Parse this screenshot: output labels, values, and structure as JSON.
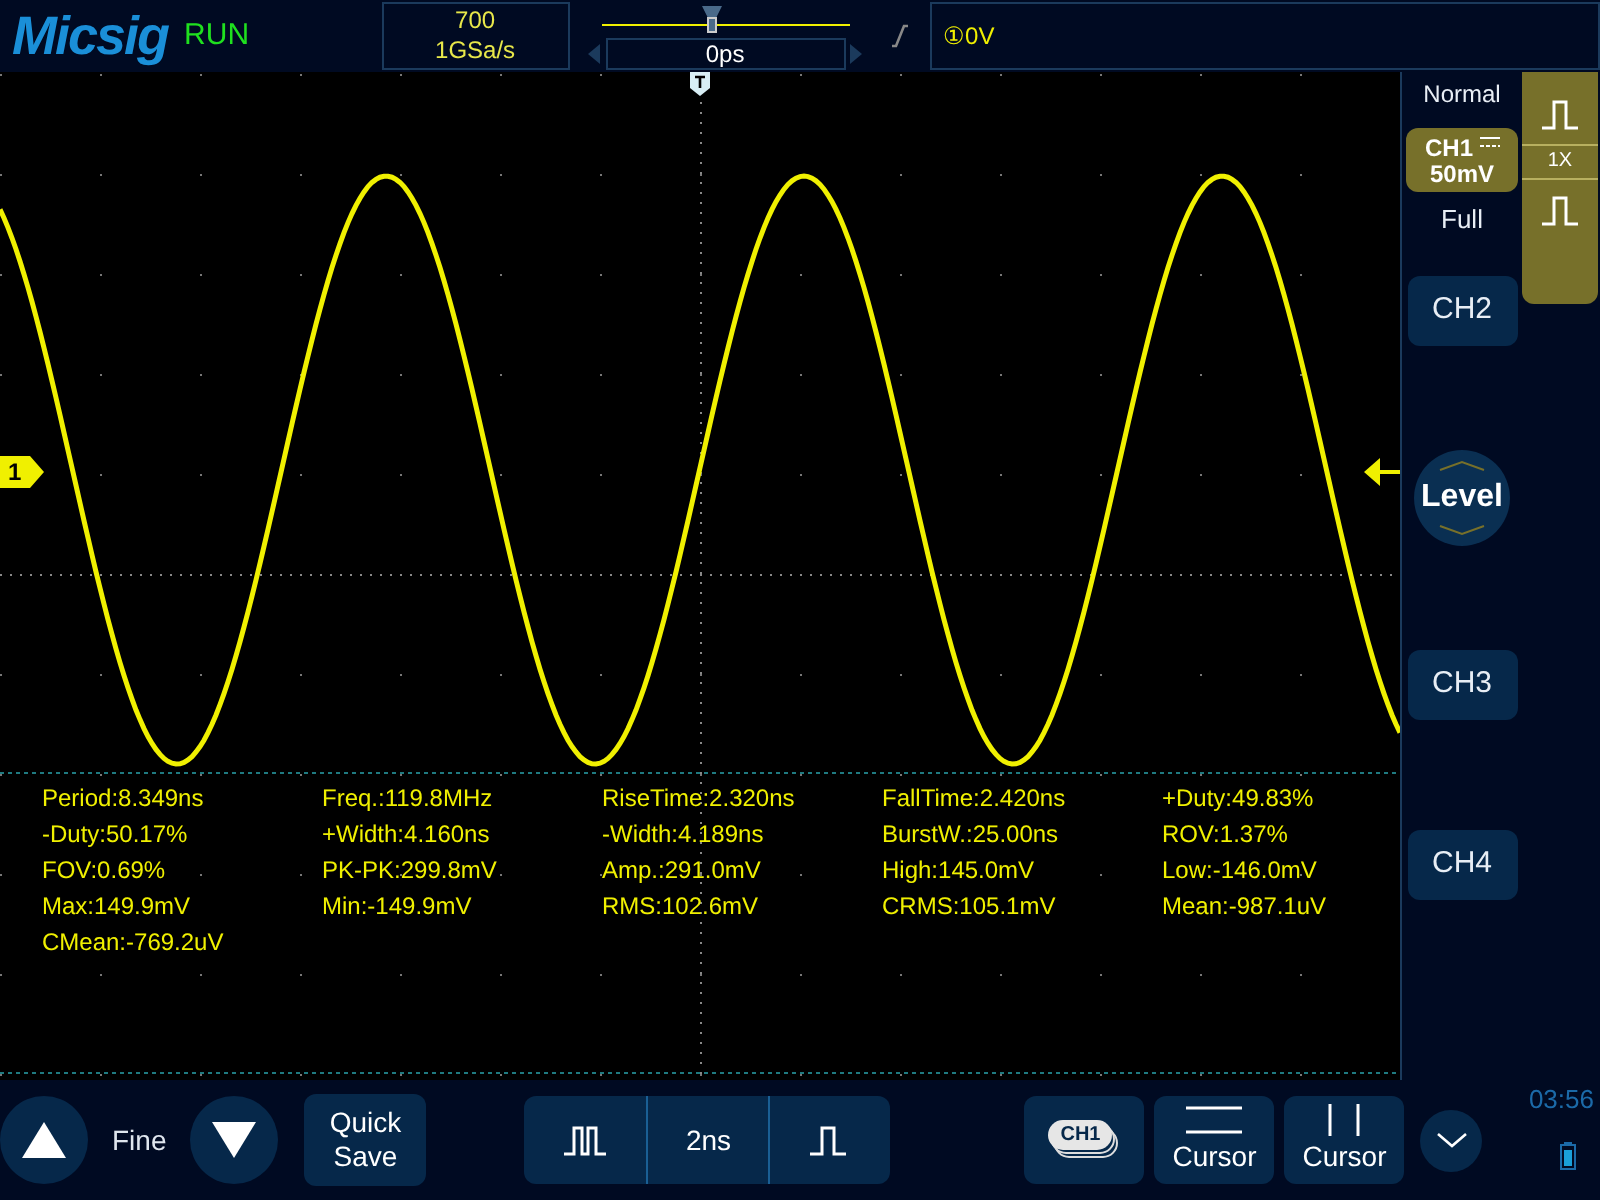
{
  "header": {
    "logo": "Micsig",
    "run_state": "RUN",
    "record_length": "700",
    "sample_rate": "1GSa/s",
    "time_offset": "0ps",
    "trigger_level": "①0V"
  },
  "trigger_mode": "Normal",
  "channel": {
    "name": "CH1",
    "scale": "50mV",
    "bandwidth": "Full",
    "probe": "1X"
  },
  "side_buttons": [
    {
      "label": "CH2",
      "kind": "button"
    },
    {
      "label": "Level",
      "kind": "knob"
    },
    {
      "label": "CH3",
      "kind": "button"
    },
    {
      "label": "CH4",
      "kind": "button"
    }
  ],
  "plot": {
    "channel_marker": "1"
  },
  "measurements": [
    "Period:8.349ns",
    "Freq.:119.8MHz",
    "RiseTime:2.320ns",
    "FallTime:2.420ns",
    "+Duty:49.83%",
    "-Duty:50.17%",
    "+Width:4.160ns",
    "-Width:4.189ns",
    "BurstW.:25.00ns",
    "ROV:1.37%",
    "FOV:0.69%",
    "PK-PK:299.8mV",
    "Amp.:291.0mV",
    "High:145.0mV",
    "Low:-146.0mV",
    "Max:149.9mV",
    "Min:-149.9mV",
    "RMS:102.6mV",
    "CRMS:105.1mV",
    "Mean:-987.1uV",
    "CMean:-769.2uV"
  ],
  "bottom_bar": {
    "step_label": "Fine",
    "quick_save": "Quick Save",
    "timebase": "2ns",
    "channel_icon": "CH1",
    "cursors": [
      "Cursor",
      "Cursor"
    ],
    "clock": "03:56"
  }
}
